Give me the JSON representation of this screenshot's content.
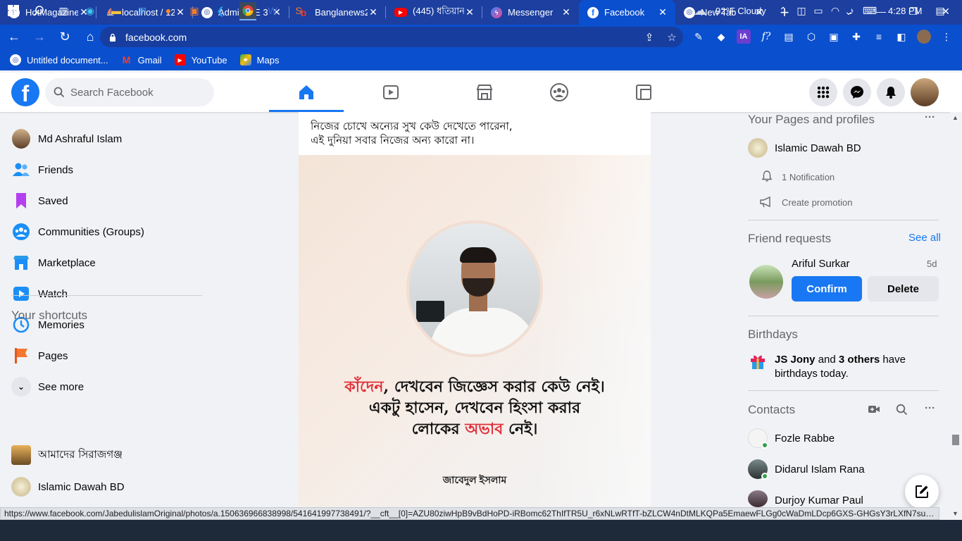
{
  "browser": {
    "tabs": [
      {
        "label": "HotMagazine",
        "icon": "chrome-icon",
        "color": "#ffffff"
      },
      {
        "label": "localhost / 12",
        "icon": "phpmyadmin-icon",
        "color": "#f0a030"
      },
      {
        "label": "AdminLTE 3 |",
        "icon": "chrome-icon",
        "color": "#ffffff"
      },
      {
        "label": "Banglanews24",
        "icon": "banglanews-icon",
        "color": "#e53935"
      },
      {
        "label": "(445) ধতিয়ান",
        "icon": "youtube-icon",
        "color": "#ff0000"
      },
      {
        "label": "Messenger",
        "icon": "messenger-icon",
        "color": "#a855f7"
      },
      {
        "label": "Facebook",
        "icon": "facebook-icon",
        "color": "#1877f2"
      },
      {
        "label": "New Tab",
        "icon": "chrome-icon",
        "color": "#ffffff"
      }
    ],
    "url": "facebook.com",
    "bookmarks": [
      {
        "label": "Untitled document...",
        "icon": "chrome-icon"
      },
      {
        "label": "Gmail",
        "icon": "gmail-icon"
      },
      {
        "label": "YouTube",
        "icon": "youtube-icon"
      },
      {
        "label": "Maps",
        "icon": "maps-icon"
      }
    ]
  },
  "facebook": {
    "search_placeholder": "Search Facebook",
    "left_nav": [
      {
        "label": "Md Ashraful Islam",
        "icon": "profile-avatar"
      },
      {
        "label": "Friends",
        "icon": "friends-icon"
      },
      {
        "label": "Saved",
        "icon": "saved-icon"
      },
      {
        "label": "Communities (Groups)",
        "icon": "groups-icon"
      },
      {
        "label": "Marketplace",
        "icon": "marketplace-icon"
      },
      {
        "label": "Watch",
        "icon": "watch-icon"
      },
      {
        "label": "Memories",
        "icon": "memories-icon"
      },
      {
        "label": "Pages",
        "icon": "pages-icon"
      },
      {
        "label": "See more",
        "icon": "chevron-down-icon"
      }
    ],
    "shortcuts_heading": "Your shortcuts",
    "shortcuts": [
      {
        "label": "আমাদের সিরাজগঞ্জ"
      },
      {
        "label": "Islamic Dawah BD"
      }
    ],
    "post": {
      "text_line1": "নিজের চোখে অন্যের সুখ কেউ দেখেতে পারেনা,",
      "text_line2": "এই দুনিয়া সবার নিজের অন্য কারো না।",
      "quote_line1_red": "কাঁদেন",
      "quote_line1_rest": ", দেখবেন জিজ্ঞেস করার কেউ নেই।",
      "quote_line2": "একটু হাসেন, দেখবেন হিংসা করার",
      "quote_line3_a": "লোকের ",
      "quote_line3_red": "অভাব",
      "quote_line3_b": " নেই।",
      "signature": "জাবেদুল ইসলাম"
    },
    "right": {
      "pages_heading": "Your Pages and profiles",
      "page_name": "Islamic Dawah BD",
      "notification": "1 Notification",
      "create_promotion": "Create promotion",
      "friend_requests_heading": "Friend requests",
      "see_all": "See all",
      "request_name": "Ariful Surkar",
      "request_age": "5d",
      "confirm": "Confirm",
      "delete": "Delete",
      "birthdays_heading": "Birthdays",
      "birthday_name": "JS Jony",
      "birthday_mid": " and ",
      "birthday_others": "3 others",
      "birthday_rest": " have",
      "birthday_line2": "birthdays today.",
      "contacts_heading": "Contacts",
      "contacts": [
        {
          "name": "Fozle Rabbe"
        },
        {
          "name": "Didarul Islam Rana"
        },
        {
          "name": "Durjoy Kumar Paul"
        }
      ]
    }
  },
  "status_url": "https://www.facebook.com/JabedulislamOriginal/photos/a.150636966838998/541641997738491/?__cft__[0]=AZU80ziwHpB9vBdHoPD-iRBomc62ThIfTR5U_r6xNLwRTfT-bZLCW4nDtMLKQPa5EmaewFLGg0cWaDmLDcp6GXS-GHGsY3rLXfN7suvSK39QY_...",
  "taskbar": {
    "weather": "92°F  Cloudy",
    "time": "4:28 PM"
  },
  "colors": {
    "chrome_frame": "#1c3fa0",
    "chrome_toolbar": "#0a4fce",
    "fb_blue": "#1877f2"
  }
}
